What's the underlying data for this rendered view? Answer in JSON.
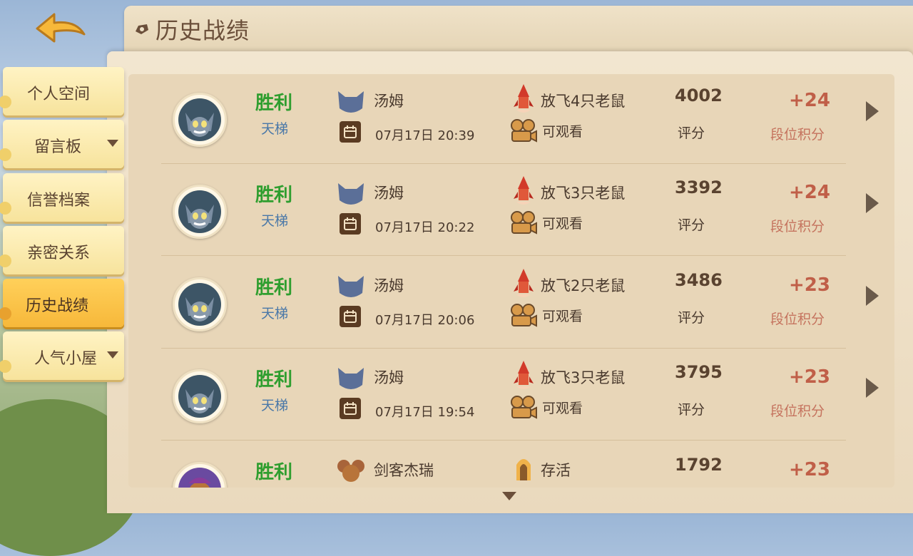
{
  "header": {
    "title": "历史战绩"
  },
  "colors": {
    "win": "#2f9e2f",
    "mode": "#4a78a8",
    "rank": "#c05f48",
    "nav_active": "#f7b83a"
  },
  "sidebar": {
    "items": [
      {
        "label": "个人空间",
        "active": false,
        "dropdown": false
      },
      {
        "label": "留言板",
        "active": false,
        "dropdown": true
      },
      {
        "label": "信誉档案",
        "active": false,
        "dropdown": false
      },
      {
        "label": "亲密关系",
        "active": false,
        "dropdown": false
      },
      {
        "label": "历史战绩",
        "active": true,
        "dropdown": false
      },
      {
        "label": "人气小屋",
        "active": false,
        "dropdown": true
      }
    ]
  },
  "matches": [
    {
      "result": "胜利",
      "mode": "天梯",
      "character": "汤姆",
      "date": "07月17日  20:39",
      "stat": "放飞4只老鼠",
      "replay": "可观看",
      "score": "4002",
      "score_label": "评分",
      "rank_delta": "+24",
      "rank_label": "段位积分",
      "char_icon": "tom-cat-icon",
      "stat_icon": "rocket-icon"
    },
    {
      "result": "胜利",
      "mode": "天梯",
      "character": "汤姆",
      "date": "07月17日  20:22",
      "stat": "放飞3只老鼠",
      "replay": "可观看",
      "score": "3392",
      "score_label": "评分",
      "rank_delta": "+24",
      "rank_label": "段位积分",
      "char_icon": "tom-cat-icon",
      "stat_icon": "rocket-icon"
    },
    {
      "result": "胜利",
      "mode": "天梯",
      "character": "汤姆",
      "date": "07月17日  20:06",
      "stat": "放飞2只老鼠",
      "replay": "可观看",
      "score": "3486",
      "score_label": "评分",
      "rank_delta": "+23",
      "rank_label": "段位积分",
      "char_icon": "tom-cat-icon",
      "stat_icon": "rocket-icon"
    },
    {
      "result": "胜利",
      "mode": "天梯",
      "character": "汤姆",
      "date": "07月17日  19:54",
      "stat": "放飞3只老鼠",
      "replay": "可观看",
      "score": "3795",
      "score_label": "评分",
      "rank_delta": "+23",
      "rank_label": "段位积分",
      "char_icon": "tom-cat-icon",
      "stat_icon": "rocket-icon"
    },
    {
      "result": "胜利",
      "mode": "",
      "character": "剑客杰瑞",
      "date": "",
      "stat": "存活",
      "replay": "",
      "score": "1792",
      "score_label": "",
      "rank_delta": "+23",
      "rank_label": "",
      "char_icon": "jerry-mouse-icon",
      "stat_icon": "survive-icon"
    }
  ]
}
